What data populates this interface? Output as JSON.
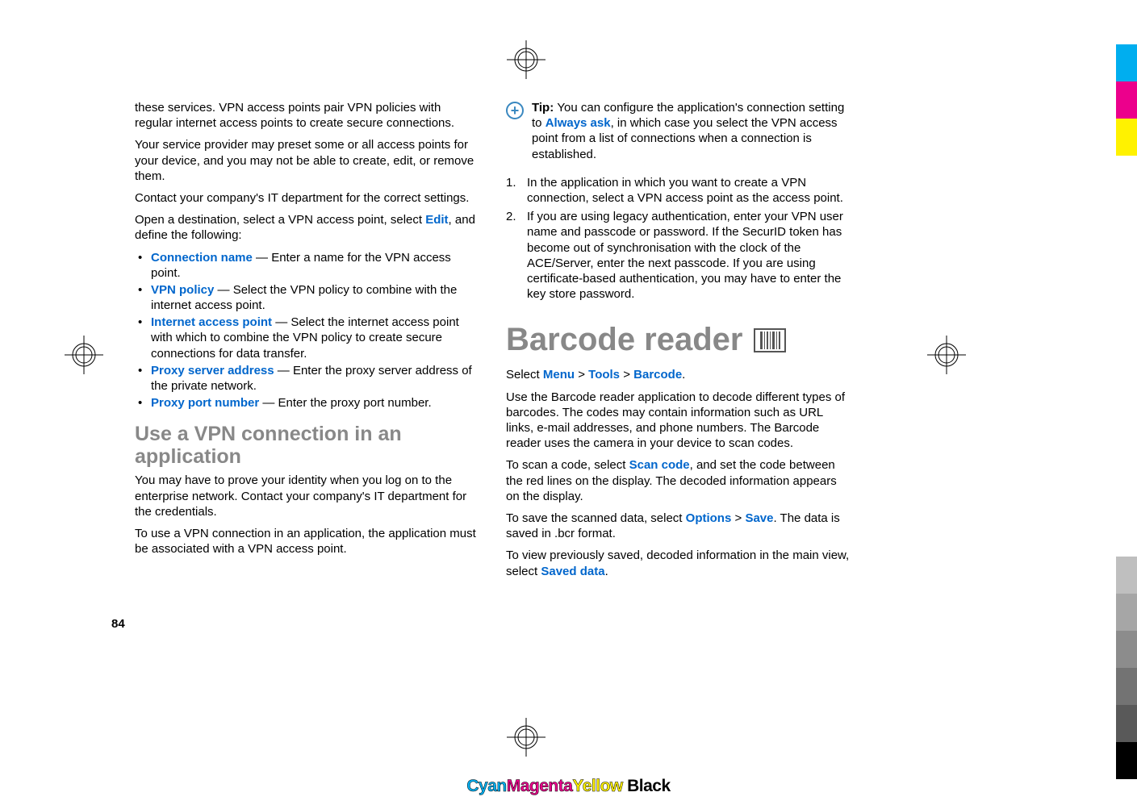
{
  "page_number": "84",
  "col1": {
    "intro1": "these services. VPN access points pair VPN policies with regular internet access points to create secure connections.",
    "intro2": "Your service provider may preset some or all access points for your device, and you may not be able to create, edit, or remove them.",
    "intro3": "Contact your company's IT department for the correct settings.",
    "open_dest_pre": "Open a destination, select a VPN access point, select ",
    "edit_link": "Edit",
    "open_dest_post": ", and define the following:",
    "bullets": {
      "conn_name": "Connection name",
      "conn_name_desc": "  — Enter a name for the VPN access point.",
      "vpn_policy": "VPN policy",
      "vpn_policy_desc": " — Select the VPN policy to combine with the internet access point.",
      "iap": "Internet access point",
      "iap_desc": " — Select the internet access point with which to combine the VPN policy to create secure connections for data transfer.",
      "proxy_addr": "Proxy server address",
      "proxy_addr_desc": " — Enter the proxy server address of the private network.",
      "proxy_port": "Proxy port number",
      "proxy_port_desc": " — Enter the proxy port number."
    },
    "section_heading": "Use a VPN connection in an application",
    "section_p1": "You may have to prove your identity when you log on to the enterprise network. Contact your company's IT department for the credentials.",
    "section_p2": "To use a VPN connection in an application, the application must be associated with a VPN access point."
  },
  "col2": {
    "tip_label": "Tip: ",
    "tip_pre": "You can configure the application's connection setting to ",
    "always_ask": "Always ask",
    "tip_post": ", in which case you select the VPN access point from a list of connections when a connection is established.",
    "step1": "In the application in which you want to create a VPN connection, select a VPN access point as the access point.",
    "step2": "If you are using legacy authentication, enter your VPN user name and passcode or password. If the SecurID token has become out of synchronisation with the clock of the ACE/Server, enter the next passcode. If you are using certificate-based authentication, you may have to enter the key store password.",
    "title": "Barcode reader",
    "select_pre": "Select ",
    "menu": "Menu",
    "gt": " > ",
    "tools": "Tools",
    "barcode": "Barcode",
    "period": ".",
    "desc": "Use the Barcode reader application to decode different types of barcodes. The codes may contain information such as URL links, e-mail addresses, and phone numbers. The Barcode reader uses the camera in your device to scan codes.",
    "scan_pre": "To scan a code, select ",
    "scan_code": "Scan code",
    "scan_post": ", and set the code between the red lines on the display. The decoded information appears on the display.",
    "save_pre": "To save the scanned data, select ",
    "options": "Options",
    "save": "Save",
    "save_post": ". The data is saved in .bcr format.",
    "view_pre": "To view previously saved, decoded information in the main view, select ",
    "saved_data": "Saved data"
  },
  "cmyk": {
    "c": "Cyan",
    "m": "Magenta",
    "y": "Yellow",
    "k": "Black"
  },
  "colors": {
    "bars": [
      "#00aeef",
      "#ec008c",
      "#fff200",
      "#a0a0a0",
      "#00a651",
      "#ed1c24",
      "#2e3192",
      "#000000"
    ],
    "grays": [
      "#bfbfbf",
      "#a6a6a6",
      "#8c8c8c",
      "#737373",
      "#595959",
      "#000000"
    ]
  }
}
